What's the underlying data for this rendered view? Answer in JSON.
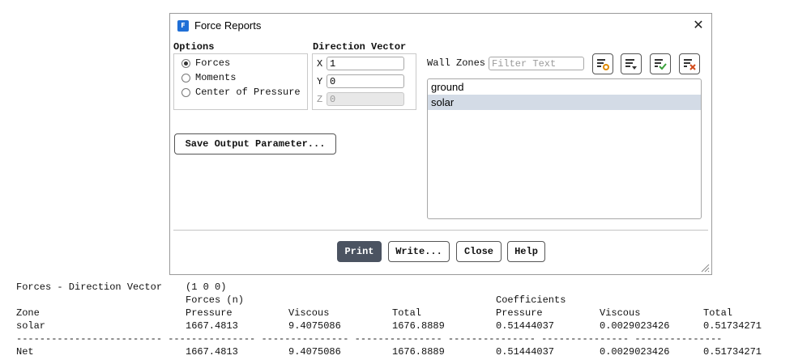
{
  "dialog": {
    "title": "Force Reports",
    "icon_letter": "F",
    "close_glyph": "✕"
  },
  "options": {
    "heading": "Options",
    "items": [
      {
        "label": "Forces",
        "checked": true
      },
      {
        "label": "Moments",
        "checked": false
      },
      {
        "label": "Center of Pressure",
        "checked": false
      }
    ]
  },
  "direction_vector": {
    "heading": "Direction Vector",
    "x": {
      "label": "X",
      "value": "1"
    },
    "y": {
      "label": "Y",
      "value": "0"
    },
    "z": {
      "label": "Z",
      "value": "0"
    }
  },
  "wall_zones": {
    "label": "Wall Zones",
    "filter_placeholder": "Filter Text",
    "tools": [
      "filter-options-icon",
      "filter-dropdown-icon",
      "select-all-icon",
      "deselect-all-icon"
    ],
    "items": [
      {
        "label": "ground",
        "selected": false
      },
      {
        "label": "solar",
        "selected": true
      }
    ]
  },
  "save_output_parameter_label": "Save Output Parameter...",
  "buttons": {
    "print": "Print",
    "write": "Write...",
    "close": "Close",
    "help": "Help"
  },
  "console": {
    "title": "Forces - Direction Vector",
    "vector": "(1 0 0)",
    "forces_header": "Forces (n)",
    "coefficients_header": "Coefficients",
    "columns": [
      "Zone",
      "Pressure",
      "Viscous",
      "Total",
      "Pressure",
      "Viscous",
      "Total"
    ],
    "rows": [
      [
        "solar",
        "1667.4813",
        "9.4075086",
        "1676.8889",
        "0.51444037",
        "0.0029023426",
        "0.51734271"
      ]
    ],
    "separator": "------------------------- --------------- --------------- --------------- --------------- --------------- ---------------",
    "net": [
      "Net",
      "1667.4813",
      "9.4075086",
      "1676.8889",
      "0.51444037",
      "0.0029023426",
      "0.51734271"
    ]
  },
  "colors": {
    "primary_button": "#4b5361",
    "selected_row": "#d3dbe6",
    "app_icon": "#1f6fd6",
    "icon_accent_orange": "#e08a00",
    "icon_accent_green": "#3aa03a",
    "icon_accent_red": "#d24a1a"
  }
}
